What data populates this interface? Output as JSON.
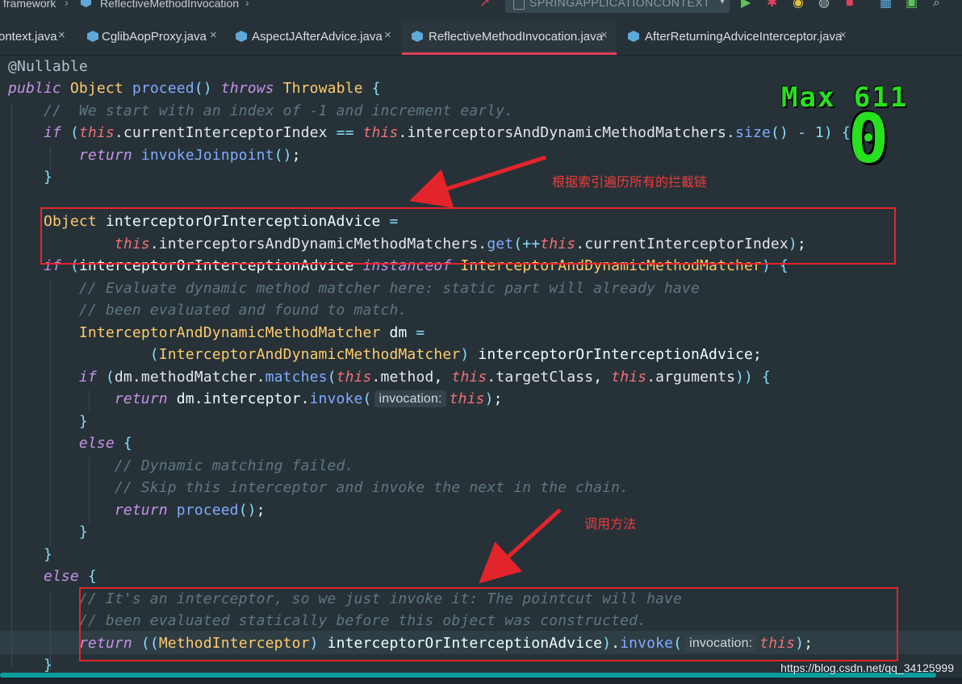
{
  "breadcrumb": {
    "items": [
      "framework",
      "ReflectiveMethodInvocation"
    ]
  },
  "toolbar": {
    "run_configuration": "SPRINGAPPLICATIONCONTEXT",
    "icons": [
      "build-hammer-icon",
      "run-icon",
      "debug-icon",
      "coverage-icon",
      "profile-icon",
      "stop-icon",
      "project-structure-icon",
      "terminal-icon",
      "search-icon"
    ]
  },
  "tabs": [
    {
      "label": "ontext.java",
      "active": false
    },
    {
      "label": "CglibAopProxy.java",
      "active": false
    },
    {
      "label": "AspectJAfterAdvice.java",
      "active": false
    },
    {
      "label": "ReflectiveMethodInvocation.java",
      "active": true
    },
    {
      "label": "AfterReturningAdviceInterceptor.java",
      "active": false
    }
  ],
  "tab_close_glyph": "×",
  "code": {
    "lines": [
      [
        [
          "ann",
          "@Nullable"
        ]
      ],
      [
        [
          "kw",
          "public"
        ],
        [
          "id",
          " "
        ],
        [
          "type",
          "Object"
        ],
        [
          "id",
          " "
        ],
        [
          "fn",
          "proceed"
        ],
        [
          "punc",
          "()"
        ],
        [
          "id",
          " "
        ],
        [
          "kw",
          "throws"
        ],
        [
          "id",
          " "
        ],
        [
          "type",
          "Throwable"
        ],
        [
          "id",
          " "
        ],
        [
          "punc",
          "{"
        ]
      ],
      [
        [
          "id",
          "    "
        ],
        [
          "com",
          "//  We start with an index of -1 and increment early."
        ]
      ],
      [
        [
          "id",
          "    "
        ],
        [
          "kw",
          "if"
        ],
        [
          "id",
          " "
        ],
        [
          "punc",
          "("
        ],
        [
          "this",
          "this"
        ],
        [
          "field",
          ".currentInterceptorIndex"
        ],
        [
          "id",
          " "
        ],
        [
          "op",
          "=="
        ],
        [
          "id",
          " "
        ],
        [
          "this",
          "this"
        ],
        [
          "field",
          ".interceptorsAndDynamicMethodMatchers."
        ],
        [
          "fn",
          "size"
        ],
        [
          "punc",
          "() - 1)"
        ],
        [
          "id",
          " "
        ],
        [
          "punc",
          "{"
        ]
      ],
      [
        [
          "id",
          "        "
        ],
        [
          "kw",
          "return"
        ],
        [
          "id",
          " "
        ],
        [
          "fn",
          "invokeJoinpoint"
        ],
        [
          "punc",
          "()"
        ],
        [
          "id",
          ";"
        ]
      ],
      [
        [
          "id",
          "    "
        ],
        [
          "punc",
          "}"
        ]
      ],
      [
        [
          "id",
          ""
        ]
      ],
      [
        [
          "id",
          "    "
        ],
        [
          "type",
          "Object"
        ],
        [
          "id",
          " interceptorOrInterceptionAdvice "
        ],
        [
          "op",
          "="
        ]
      ],
      [
        [
          "id",
          "            "
        ],
        [
          "this",
          "this"
        ],
        [
          "field",
          ".interceptorsAndDynamicMethodMatchers."
        ],
        [
          "fn",
          "get"
        ],
        [
          "punc",
          "("
        ],
        [
          "op",
          "++"
        ],
        [
          "this",
          "this"
        ],
        [
          "field",
          ".currentInterceptorIndex"
        ],
        [
          "punc",
          ")"
        ],
        [
          "id",
          ";"
        ]
      ],
      [
        [
          "id",
          "    "
        ],
        [
          "kw",
          "if"
        ],
        [
          "id",
          " "
        ],
        [
          "punc",
          "("
        ],
        [
          "id",
          "interceptorOrInterceptionAdvice "
        ],
        [
          "kw",
          "instanceof"
        ],
        [
          "id",
          " "
        ],
        [
          "type",
          "InterceptorAndDynamicMethodMatcher"
        ],
        [
          "punc",
          ")"
        ],
        [
          "id",
          " "
        ],
        [
          "punc",
          "{"
        ]
      ],
      [
        [
          "id",
          "        "
        ],
        [
          "com",
          "// Evaluate dynamic method matcher here: static part will already have"
        ]
      ],
      [
        [
          "id",
          "        "
        ],
        [
          "com",
          "// been evaluated and found to match."
        ]
      ],
      [
        [
          "id",
          "        "
        ],
        [
          "type",
          "InterceptorAndDynamicMethodMatcher"
        ],
        [
          "id",
          " dm "
        ],
        [
          "op",
          "="
        ]
      ],
      [
        [
          "id",
          "                "
        ],
        [
          "punc",
          "("
        ],
        [
          "type",
          "InterceptorAndDynamicMethodMatcher"
        ],
        [
          "punc",
          ")"
        ],
        [
          "id",
          " interceptorOrInterceptionAdvice;"
        ]
      ],
      [
        [
          "id",
          "        "
        ],
        [
          "kw",
          "if"
        ],
        [
          "id",
          " "
        ],
        [
          "punc",
          "("
        ],
        [
          "field",
          "dm.methodMatcher."
        ],
        [
          "fn",
          "matches"
        ],
        [
          "punc",
          "("
        ],
        [
          "this",
          "this"
        ],
        [
          "field",
          ".method"
        ],
        [
          "id",
          ", "
        ],
        [
          "this",
          "this"
        ],
        [
          "field",
          ".targetClass"
        ],
        [
          "id",
          ", "
        ],
        [
          "this",
          "this"
        ],
        [
          "field",
          ".arguments"
        ],
        [
          "punc",
          "))"
        ],
        [
          "id",
          " "
        ],
        [
          "punc",
          "{"
        ]
      ],
      [
        [
          "id",
          "            "
        ],
        [
          "kw",
          "return"
        ],
        [
          "id",
          " dm.interceptor."
        ],
        [
          "fn",
          "invoke"
        ],
        [
          "punc",
          "("
        ],
        [
          "hint",
          "invocation:"
        ],
        [
          "this",
          "this"
        ],
        [
          "punc",
          ")"
        ],
        [
          "id",
          ";"
        ]
      ],
      [
        [
          "id",
          "        "
        ],
        [
          "punc",
          "}"
        ]
      ],
      [
        [
          "id",
          "        "
        ],
        [
          "kw",
          "else"
        ],
        [
          "id",
          " "
        ],
        [
          "punc",
          "{"
        ]
      ],
      [
        [
          "id",
          "            "
        ],
        [
          "com",
          "// Dynamic matching failed."
        ]
      ],
      [
        [
          "id",
          "            "
        ],
        [
          "com",
          "// Skip this interceptor and invoke the next in the chain."
        ]
      ],
      [
        [
          "id",
          "            "
        ],
        [
          "kw",
          "return"
        ],
        [
          "id",
          " "
        ],
        [
          "fn",
          "proceed"
        ],
        [
          "punc",
          "()"
        ],
        [
          "id",
          ";"
        ]
      ],
      [
        [
          "id",
          "        "
        ],
        [
          "punc",
          "}"
        ]
      ],
      [
        [
          "id",
          "    "
        ],
        [
          "punc",
          "}"
        ]
      ],
      [
        [
          "id",
          "    "
        ],
        [
          "kw",
          "else"
        ],
        [
          "id",
          " "
        ],
        [
          "punc",
          "{"
        ]
      ],
      [
        [
          "id",
          "        "
        ],
        [
          "com",
          "// It's an interceptor, so we just invoke it: The pointcut will have"
        ]
      ],
      [
        [
          "id",
          "        "
        ],
        [
          "com",
          "// been evaluated statically before this object was constructed."
        ]
      ],
      [
        [
          "id",
          "        "
        ],
        [
          "kw",
          "return"
        ],
        [
          "id",
          " "
        ],
        [
          "punc",
          "(("
        ],
        [
          "type",
          "MethodInterceptor"
        ],
        [
          "punc",
          ")"
        ],
        [
          "id",
          " interceptorOrInterceptionAdvice"
        ],
        [
          "punc",
          ")"
        ],
        [
          "id",
          "."
        ],
        [
          "fn",
          "invoke"
        ],
        [
          "punc",
          "("
        ],
        [
          "hint",
          "invocation:"
        ],
        [
          "this",
          "this"
        ],
        [
          "punc",
          ")"
        ],
        [
          "id",
          ";"
        ]
      ],
      [
        [
          "id",
          "    "
        ],
        [
          "punc",
          "}"
        ]
      ]
    ]
  },
  "annotations": {
    "note_1": "根据索引遍历所有的拦截链",
    "note_2": "调用方法",
    "color": "#e3242b"
  },
  "overlay": {
    "max_label": "Max 611",
    "counter": "0",
    "color": "#27e11e"
  },
  "watermark": "https://blog.csdn.net/qq_34125999",
  "colors": {
    "background": "#263238",
    "keyword": "#c792ea",
    "type": "#ffcb6b",
    "function": "#82aaff",
    "comment": "#5f7681",
    "this": "#f07178",
    "active_tab_underline": "#e2405a"
  }
}
